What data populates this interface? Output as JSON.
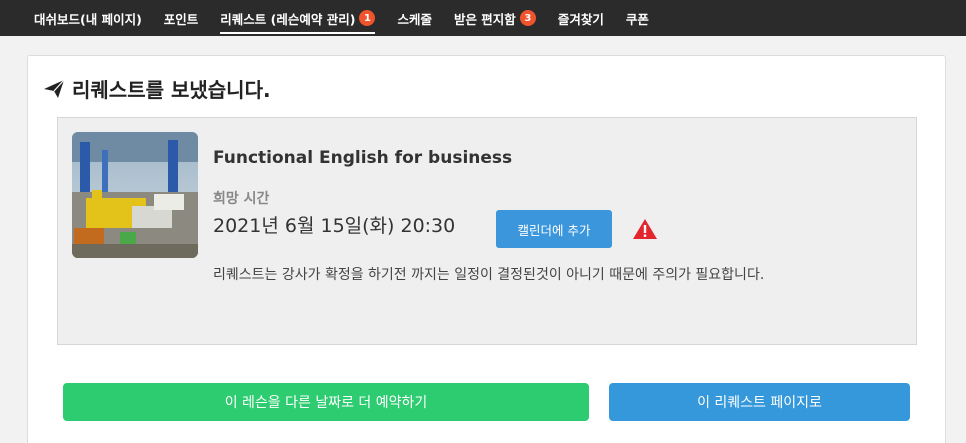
{
  "nav": {
    "items": [
      {
        "label": "대쉬보드(내 페이지)",
        "badge": null,
        "active": false
      },
      {
        "label": "포인트",
        "badge": null,
        "active": false
      },
      {
        "label": "리퀘스트 (레슨예약 관리)",
        "badge": "1",
        "active": true
      },
      {
        "label": "스케줄",
        "badge": null,
        "active": false
      },
      {
        "label": "받은 편지함",
        "badge": "3",
        "active": false
      },
      {
        "label": "즐겨찾기",
        "badge": null,
        "active": false
      },
      {
        "label": "쿠폰",
        "badge": null,
        "active": false
      }
    ]
  },
  "page": {
    "heading": "리퀘스트를 보냈습니다.",
    "icon": "paper-plane-icon"
  },
  "request": {
    "course_title": "Functional English for business",
    "time_label": "희망 시간",
    "time_value": "2021년 6월 15일(화) 20:30",
    "calendar_button": "캘린더에 추가",
    "warning_icon": "warning-triangle-icon",
    "notice": "리퀘스트는 강사가 확정을 하기전 까지는 일정이 결정된것이 아니기 때문에 주의가 필요합니다."
  },
  "actions": {
    "rebook": "이 레슨을 다른 날짜로 더 예약하기",
    "go_request": "이 리퀘스트 페이지로"
  },
  "colors": {
    "nav_bg": "#2b2b2b",
    "badge": "#f0542d",
    "primary_blue": "#3498db",
    "green": "#2ecc71",
    "warning": "#e3262e"
  }
}
